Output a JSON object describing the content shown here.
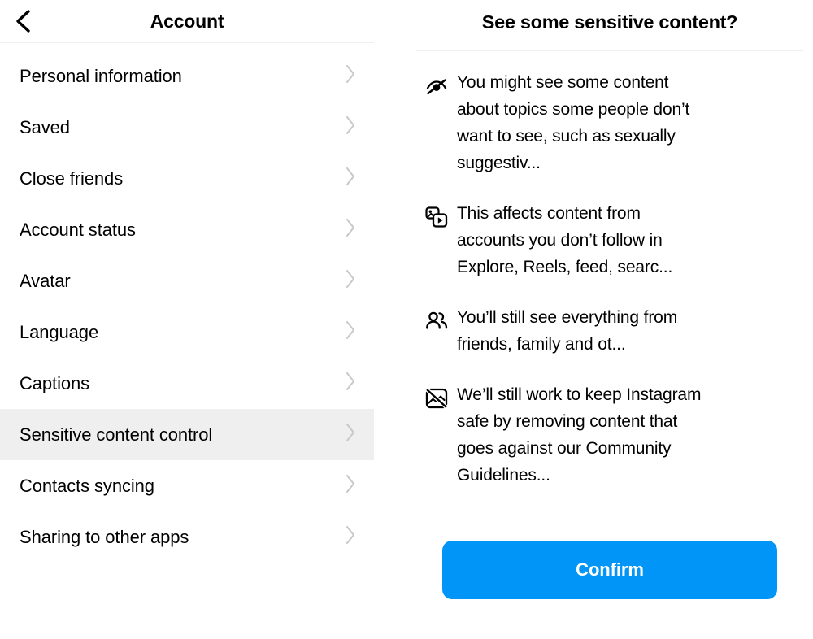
{
  "left_panel": {
    "header": {
      "back_icon": "chevron-left-icon",
      "title": "Account"
    },
    "items": [
      {
        "label": "Personal information",
        "chevron": "chevron-right-icon",
        "highlighted": false
      },
      {
        "label": "Saved",
        "chevron": "chevron-right-icon",
        "highlighted": false
      },
      {
        "label": "Close friends",
        "chevron": "chevron-right-icon",
        "highlighted": false
      },
      {
        "label": "Account status",
        "chevron": "chevron-right-icon",
        "highlighted": false
      },
      {
        "label": "Avatar",
        "chevron": "chevron-right-icon",
        "highlighted": false
      },
      {
        "label": "Language",
        "chevron": "chevron-right-icon",
        "highlighted": false
      },
      {
        "label": "Captions",
        "chevron": "chevron-right-icon",
        "highlighted": false
      },
      {
        "label": "Sensitive content control",
        "chevron": "chevron-right-icon",
        "highlighted": true
      },
      {
        "label": "Contacts syncing",
        "chevron": "chevron-right-icon",
        "highlighted": false
      },
      {
        "label": "Sharing to other apps",
        "chevron": "chevron-right-icon",
        "highlighted": false
      }
    ]
  },
  "right_panel": {
    "title": "See some sensitive content?",
    "items": [
      {
        "icon": "eye-off-icon",
        "text": "You might see some content about topics some people don’t want to see, such as sexually suggestiv..."
      },
      {
        "icon": "media-reels-icon",
        "text": "This affects content from accounts you don’t follow in Explore, Reels, feed, searc..."
      },
      {
        "icon": "people-icon",
        "text": "You’ll still see everything from friends, family and ot..."
      },
      {
        "icon": "image-off-icon",
        "text": "We’ll still work to keep Instagram safe by removing content that goes against our Community Guidelines..."
      }
    ],
    "confirm_label": "Confirm"
  },
  "colors": {
    "accent": "#0095F6",
    "highlight_row": "#EFEFEF",
    "divider": "#EFEFEF",
    "text": "#000000",
    "chevron": "#C7C7C7"
  }
}
